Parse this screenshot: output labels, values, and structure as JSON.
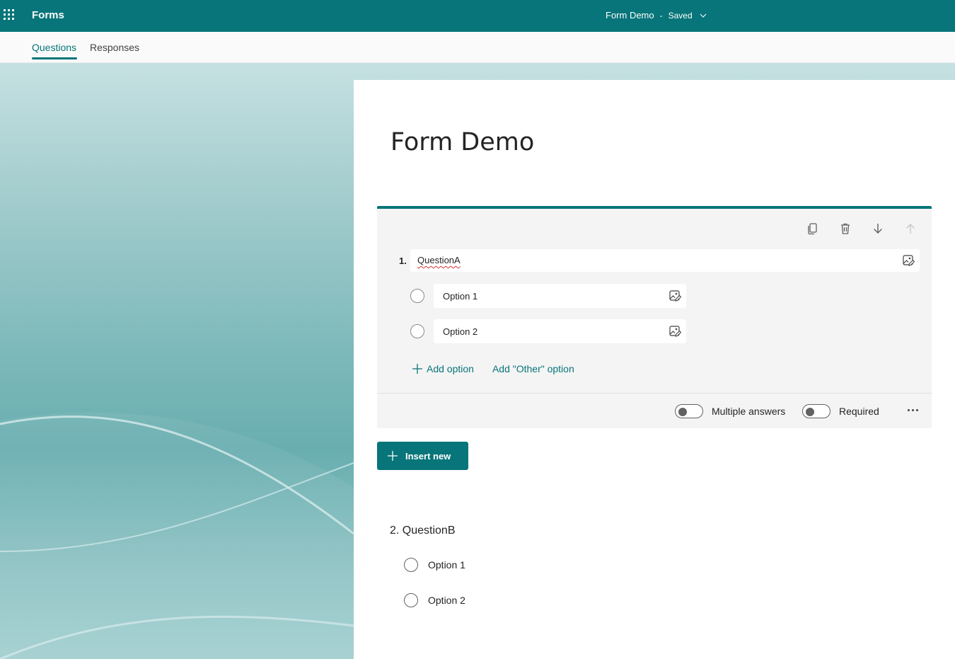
{
  "app": {
    "name": "Forms"
  },
  "header": {
    "form_name": "Form Demo",
    "separator": "-",
    "status": "Saved"
  },
  "tabs": [
    {
      "label": "Questions",
      "active": true
    },
    {
      "label": "Responses",
      "active": false
    }
  ],
  "form": {
    "title": "Form Demo",
    "questions": [
      {
        "number": "1.",
        "title": "QuestionA",
        "options": [
          {
            "label": "Option 1"
          },
          {
            "label": "Option 2"
          }
        ],
        "add_option_label": "Add option",
        "add_other_label": "Add \"Other\" option",
        "multiple_answers_label": "Multiple answers",
        "multiple_answers_on": false,
        "required_label": "Required",
        "required_on": false
      },
      {
        "display_title": "2. QuestionB",
        "options": [
          {
            "label": "Option 1"
          },
          {
            "label": "Option 2"
          }
        ]
      }
    ],
    "insert_new_label": "Insert new"
  },
  "colors": {
    "accent": "#077579",
    "card_bg": "#f4f4f4",
    "spell_error": "#d13438"
  },
  "icons": {
    "app_launcher": "waffle-icon",
    "toolbar": [
      "copy-icon",
      "delete-icon",
      "move-down-icon",
      "move-up-icon"
    ],
    "insert_media": "image-edit-icon",
    "add": "plus-icon",
    "more": "more-icon"
  }
}
